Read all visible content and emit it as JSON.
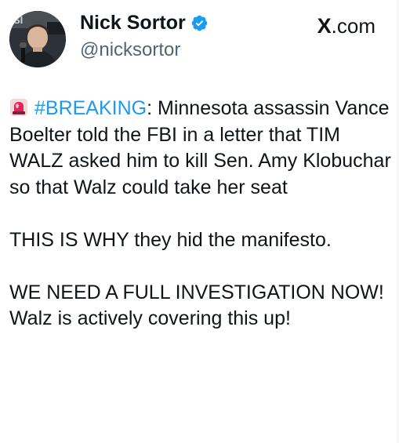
{
  "author": {
    "display_name": "Nick Sortor",
    "handle": "@nicksortor",
    "verified": true,
    "avatar_caption": "SI"
  },
  "source": {
    "label": ".com",
    "mark": "X"
  },
  "tweet": {
    "hashtag": "#BREAKING",
    "paragraph1_rest": ": Minnesota assassin Vance Boelter told the FBI in a letter that TIM WALZ asked him to kill Sen. Amy Klobuchar so that Walz could take her seat",
    "paragraph2": "THIS IS WHY they hid the manifesto.",
    "paragraph3": "WE NEED A FULL INVESTIGATION NOW! Walz is actively covering this up!",
    "lead_icon": "siren-icon"
  },
  "colors": {
    "text": "#0f1419",
    "secondary": "#536471",
    "accent": "#1d9bf0",
    "siren": "#e0245e"
  }
}
